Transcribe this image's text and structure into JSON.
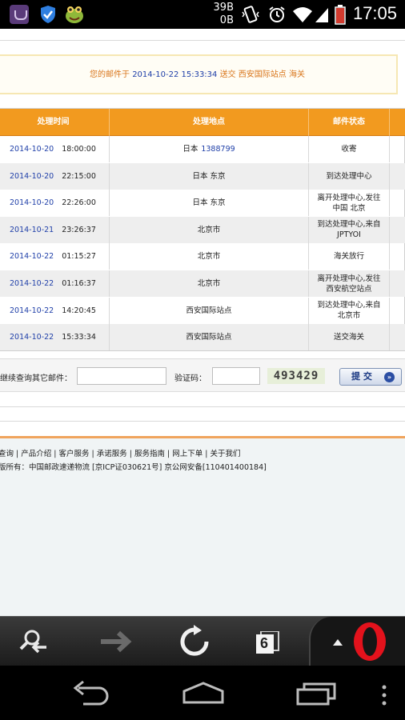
{
  "status_bar": {
    "data_up": "39B",
    "data_down": "0B",
    "time": "17:05"
  },
  "notice": {
    "prefix": "您的邮件于 ",
    "datetime": "2014-10-22 15:33:34",
    "suffix": " 送交 西安国际站点 海关"
  },
  "table": {
    "headers": [
      "处理时间",
      "处理地点",
      "邮件状态"
    ],
    "rows": [
      {
        "date": "2014-10-20",
        "hms": "18:00:00",
        "place": "日本",
        "place_num": "1388799",
        "status": "收寄"
      },
      {
        "date": "2014-10-20",
        "hms": "22:15:00",
        "place": "日本 东京",
        "place_num": "",
        "status": "到达处理中心"
      },
      {
        "date": "2014-10-20",
        "hms": "22:26:00",
        "place": "日本 东京",
        "place_num": "",
        "status": "离开处理中心,发往中国 北京"
      },
      {
        "date": "2014-10-21",
        "hms": "23:26:37",
        "place": "北京市",
        "place_num": "",
        "status": "到达处理中心,来自JPTYOI"
      },
      {
        "date": "2014-10-22",
        "hms": "01:15:27",
        "place": "北京市",
        "place_num": "",
        "status": "海关放行"
      },
      {
        "date": "2014-10-22",
        "hms": "01:16:37",
        "place": "北京市",
        "place_num": "",
        "status": "离开处理中心,发往西安航空站点"
      },
      {
        "date": "2014-10-22",
        "hms": "14:20:45",
        "place": "西安国际站点",
        "place_num": "",
        "status": "到达处理中心,来自北京市"
      },
      {
        "date": "2014-10-22",
        "hms": "15:33:34",
        "place": "西安国际站点",
        "place_num": "",
        "status": "送交海关"
      }
    ]
  },
  "query": {
    "label": "继续查询其它邮件：",
    "code_label": "验证码：",
    "captcha": "493429",
    "submit_label": "提 交"
  },
  "footer": {
    "links": "查询 | 产品介绍 | 客户服务 | 承诺服务 | 服务指南 | 网上下单 | 关于我们",
    "copyright": "版所有：中国邮政速递物流 [京ICP证030621号] 京公网安备[110401400184]"
  },
  "toolbar": {
    "tab_count": "6"
  },
  "colors": {
    "header_orange": "#f29a1f",
    "link_blue": "#1f3fa8",
    "notice_orange": "#d9751a",
    "opera_red": "#e3121c"
  }
}
